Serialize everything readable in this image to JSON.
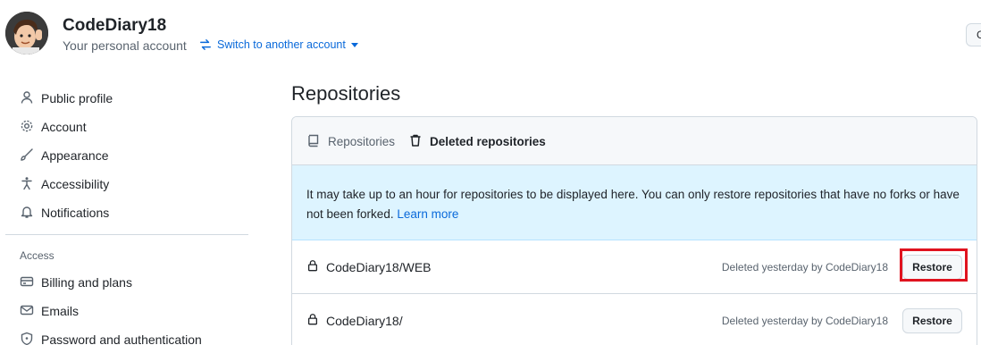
{
  "account": {
    "name": "CodeDiary18",
    "subtitle": "Your personal account",
    "switch_label": "Switch to another account",
    "go_button_label": "G"
  },
  "sidebar": {
    "items": [
      {
        "label": "Public profile",
        "icon": "person-icon"
      },
      {
        "label": "Account",
        "icon": "gear-icon"
      },
      {
        "label": "Appearance",
        "icon": "paintbrush-icon"
      },
      {
        "label": "Accessibility",
        "icon": "accessibility-icon"
      },
      {
        "label": "Notifications",
        "icon": "bell-icon"
      }
    ],
    "access_heading": "Access",
    "access_items": [
      {
        "label": "Billing and plans",
        "icon": "credit-card-icon"
      },
      {
        "label": "Emails",
        "icon": "mail-icon"
      },
      {
        "label": "Password and authentication",
        "icon": "shield-lock-icon"
      }
    ]
  },
  "main": {
    "title": "Repositories",
    "tabs": [
      {
        "label": "Repositories",
        "icon": "repo-icon",
        "active": false
      },
      {
        "label": "Deleted repositories",
        "icon": "trash-icon",
        "active": true
      }
    ],
    "notice_text": "It may take up to an hour for repositories to be displayed here. You can only restore repositories that have no forks or have not been forked.",
    "notice_link": "Learn more",
    "repos": [
      {
        "name": "CodeDiary18/WEB",
        "meta": "Deleted yesterday by CodeDiary18",
        "action": "Restore",
        "highlighted": true
      },
      {
        "name": "CodeDiary18/",
        "meta": "Deleted yesterday by CodeDiary18",
        "action": "Restore",
        "highlighted": false
      }
    ]
  },
  "colors": {
    "accent_link": "#0969da",
    "notice_bg": "#ddf4ff",
    "highlight": "#e0131f"
  }
}
